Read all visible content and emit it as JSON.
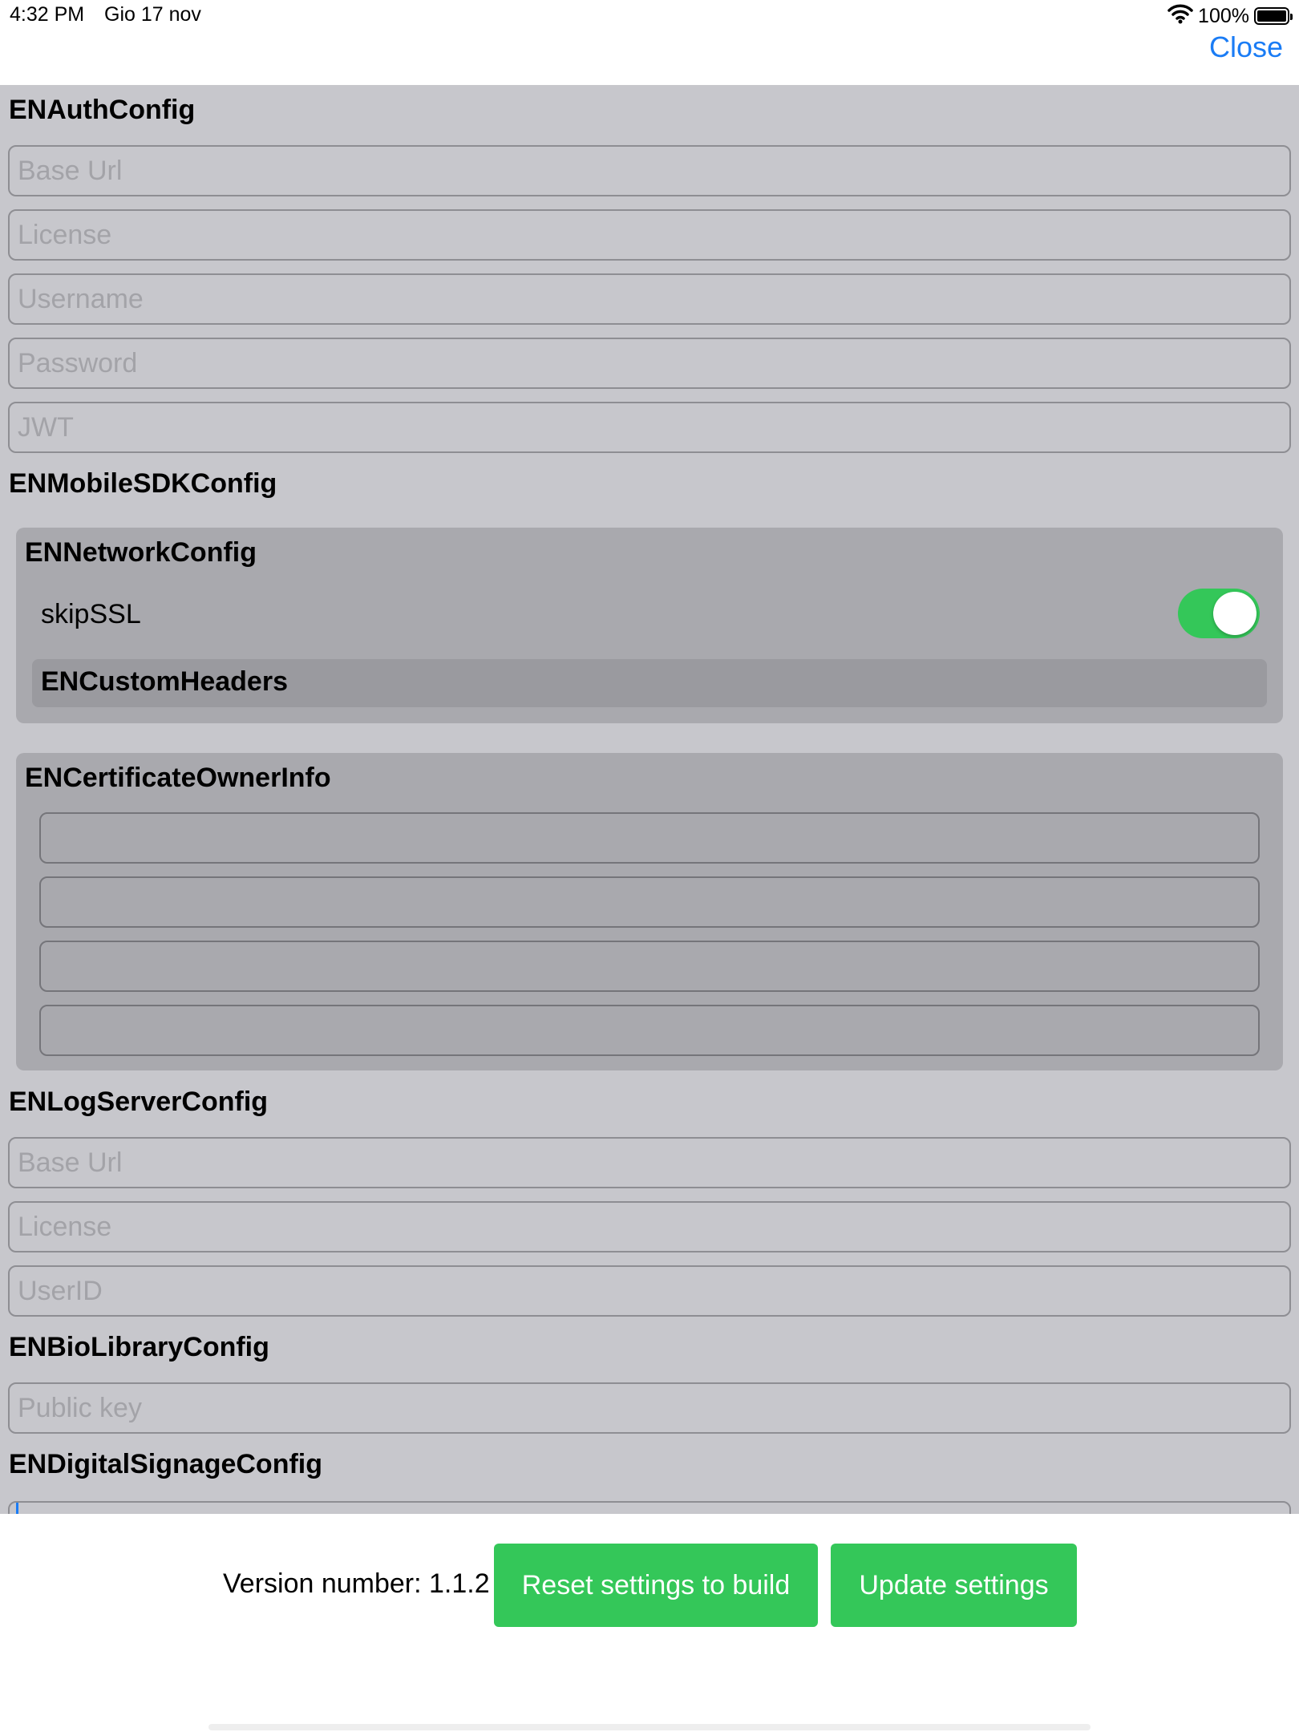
{
  "status_bar": {
    "time": "4:32 PM",
    "date": "Gio 17 nov",
    "battery": "100%"
  },
  "header": {
    "close_label": "Close"
  },
  "auth_config": {
    "title": "ENAuthConfig",
    "fields": [
      {
        "placeholder": "Base Url",
        "value": ""
      },
      {
        "placeholder": "License",
        "value": ""
      },
      {
        "placeholder": "Username",
        "value": ""
      },
      {
        "placeholder": "Password",
        "value": ""
      },
      {
        "placeholder": "JWT",
        "value": ""
      }
    ]
  },
  "mobile_sdk_config": {
    "title": "ENMobileSDKConfig",
    "network_config": {
      "title": "ENNetworkConfig",
      "skip_ssl": {
        "label": "skipSSL",
        "on": true
      },
      "custom_headers_title": "ENCustomHeaders"
    },
    "certificate_owner_info": {
      "title": "ENCertificateOwnerInfo",
      "fields": [
        {
          "value": ""
        },
        {
          "value": ""
        },
        {
          "value": ""
        },
        {
          "value": ""
        }
      ]
    }
  },
  "log_server_config": {
    "title": "ENLogServerConfig",
    "fields": [
      {
        "placeholder": "Base Url",
        "value": ""
      },
      {
        "placeholder": "License",
        "value": ""
      },
      {
        "placeholder": "UserID",
        "value": ""
      }
    ]
  },
  "bio_library_config": {
    "title": "ENBioLibraryConfig",
    "fields": [
      {
        "placeholder": "Public key",
        "value": ""
      }
    ]
  },
  "digital_signage_config": {
    "title": "ENDigitalSignageConfig"
  },
  "footer": {
    "version_label": "Version number: 1.1.2",
    "reset_label": "Reset settings to build",
    "update_label": "Update settings"
  },
  "colors": {
    "accent": "#1a7cf5",
    "button_green": "#34c759",
    "content_bg": "#c7c7cc",
    "panel_bg": "#a9a9ae",
    "subpanel_bg": "#9a9a9f"
  },
  "icons": [
    "wifi-icon",
    "battery-icon"
  ]
}
